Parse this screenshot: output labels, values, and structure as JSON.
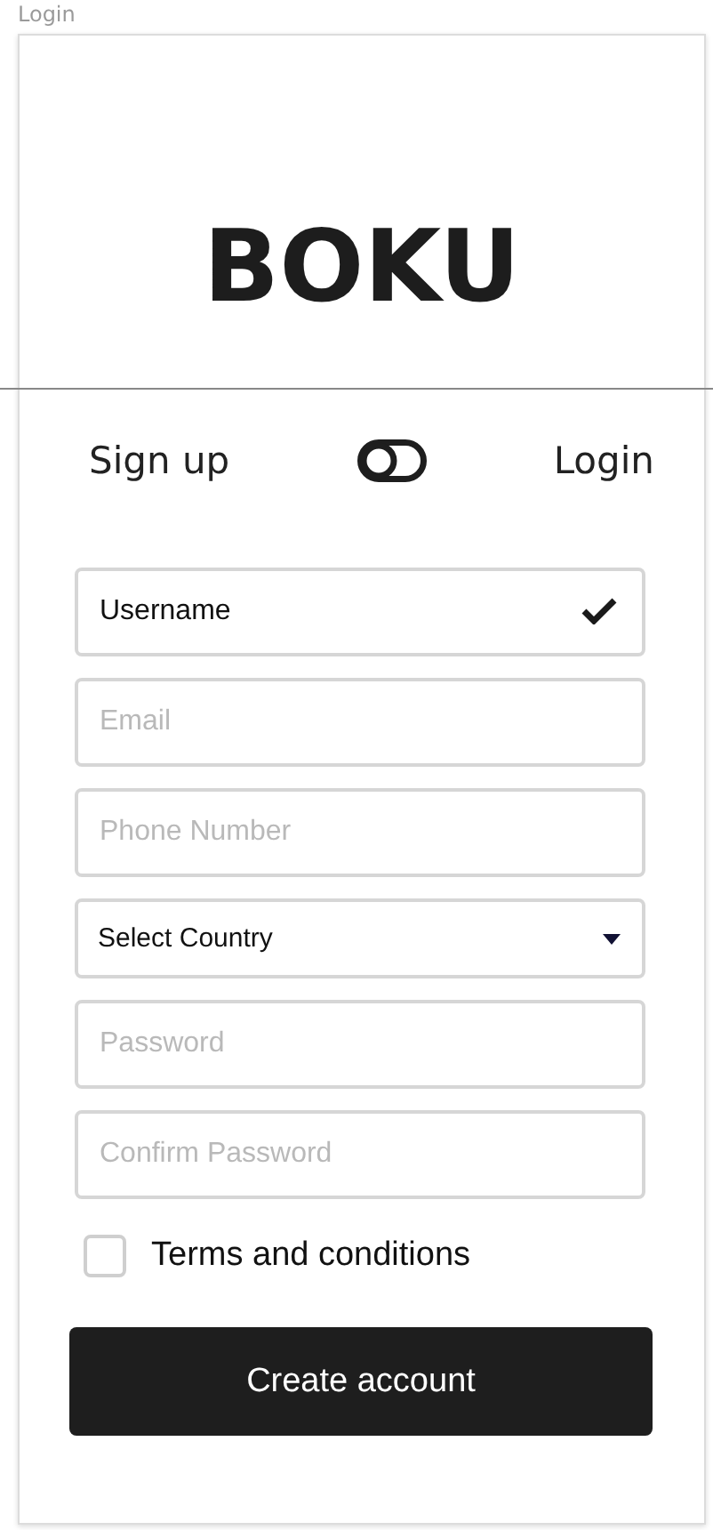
{
  "frame_label": "Login",
  "logo": "BOKU",
  "mode_switch": {
    "left_label": "Sign up",
    "right_label": "Login",
    "on": false
  },
  "fields": [
    {
      "kind": "text",
      "value": "Username",
      "valid": true
    },
    {
      "kind": "text",
      "placeholder": "Email",
      "valid": false
    },
    {
      "kind": "text",
      "placeholder": "Phone Number",
      "valid": false
    },
    {
      "kind": "select",
      "value": "Select Country"
    },
    {
      "kind": "text",
      "placeholder": "Password",
      "valid": false
    },
    {
      "kind": "text",
      "placeholder": "Confirm Password",
      "valid": false
    }
  ],
  "terms": {
    "label": "Terms and conditions",
    "checked": false
  },
  "submit_button": "Create account"
}
